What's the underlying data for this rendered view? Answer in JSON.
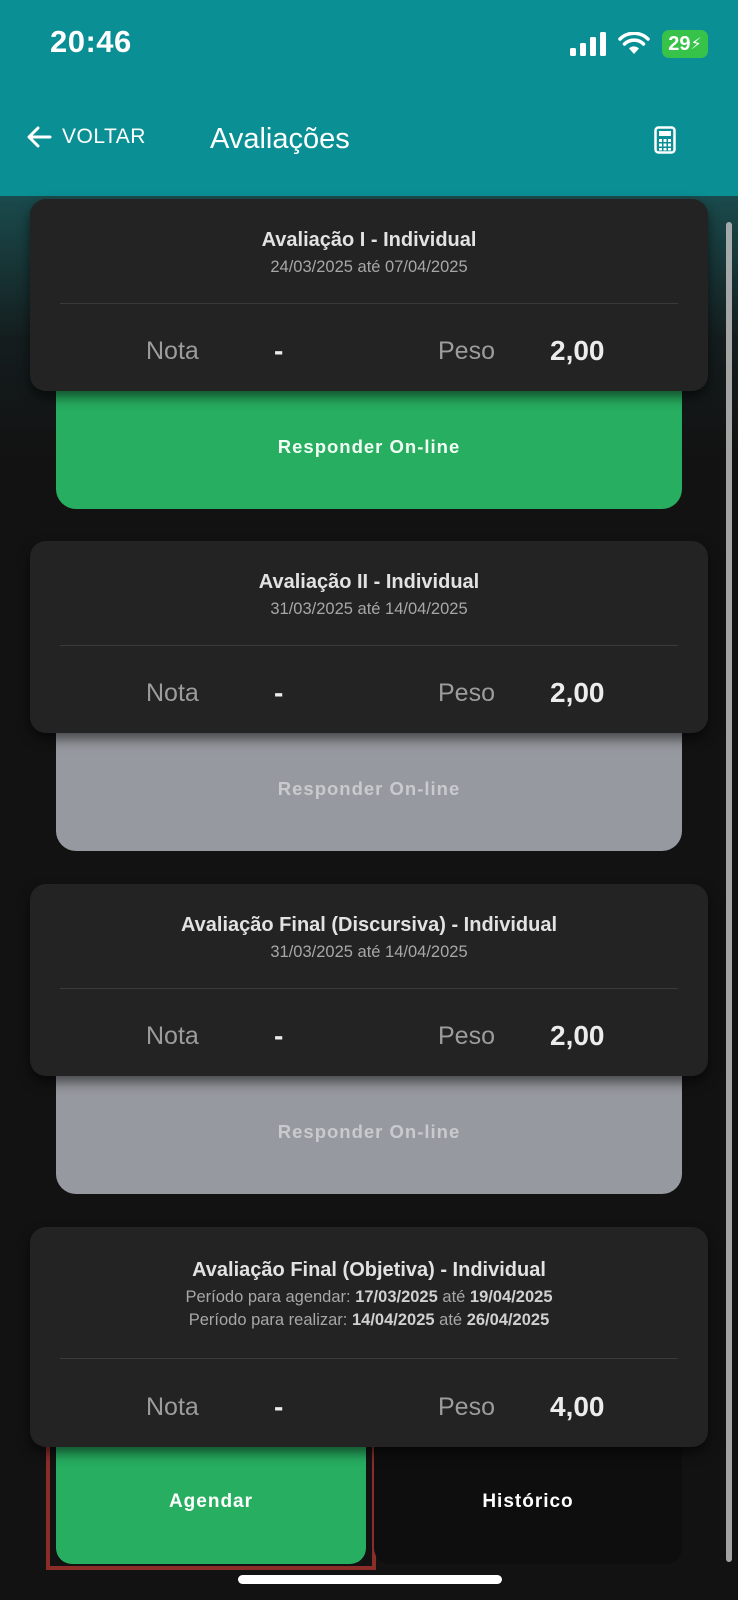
{
  "status_bar": {
    "time": "20:46",
    "battery": "29"
  },
  "header": {
    "back_label": "VOLTAR",
    "title": "Avaliações"
  },
  "cards": [
    {
      "title": "Avaliação I - Individual",
      "dates": "24/03/2025 até 07/04/2025",
      "nota_label": "Nota",
      "nota_value": "-",
      "peso_label": "Peso",
      "peso_value": "2,00",
      "action_label": "Responder On-line",
      "action_enabled": true
    },
    {
      "title": "Avaliação II - Individual",
      "dates": "31/03/2025 até 14/04/2025",
      "nota_label": "Nota",
      "nota_value": "-",
      "peso_label": "Peso",
      "peso_value": "2,00",
      "action_label": "Responder On-line",
      "action_enabled": false
    },
    {
      "title": "Avaliação Final (Discursiva) - Individual",
      "dates": "31/03/2025 até 14/04/2025",
      "nota_label": "Nota",
      "nota_value": "-",
      "peso_label": "Peso",
      "peso_value": "2,00",
      "action_label": "Responder On-line",
      "action_enabled": false
    },
    {
      "title": "Avaliação Final (Objetiva) - Individual",
      "agendar_label": "Período para agendar:",
      "agendar_start": "17/03/2025",
      "agendar_sep": "até",
      "agendar_end": "19/04/2025",
      "realizar_label": "Período para realizar:",
      "realizar_start": "14/04/2025",
      "realizar_sep": "até",
      "realizar_end": "26/04/2025",
      "nota_label": "Nota",
      "nota_value": "-",
      "peso_label": "Peso",
      "peso_value": "4,00",
      "agendar_button": "Agendar",
      "historico_button": "Histórico"
    }
  ],
  "colors": {
    "header": "#0a8f95",
    "active": "#27ae60",
    "disabled": "#96999f",
    "card": "#232323"
  }
}
